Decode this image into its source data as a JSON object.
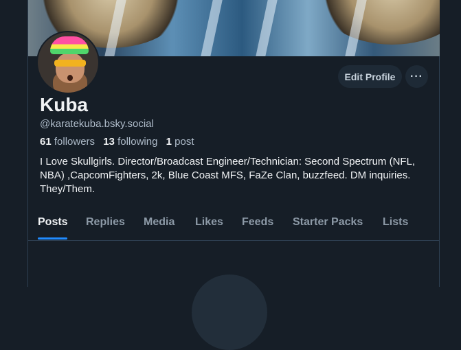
{
  "profile": {
    "display_name": "Kuba",
    "handle": "@karatekuba.bsky.social",
    "followers_count": "61",
    "followers_label": "followers",
    "following_count": "13",
    "following_label": "following",
    "posts_count": "1",
    "posts_label": "post",
    "bio": "I Love Skullgirls. Director/Broadcast Engineer/Technician: Second Spectrum (NFL, NBA) ,CapcomFighters, 2k, Blue Coast MFS, FaZe Clan, buzzfeed. DM inquiries. They/Them."
  },
  "actions": {
    "edit_profile_label": "Edit Profile",
    "more_label": "···"
  },
  "tabs": [
    {
      "label": "Posts",
      "active": true
    },
    {
      "label": "Replies",
      "active": false
    },
    {
      "label": "Media",
      "active": false
    },
    {
      "label": "Likes",
      "active": false
    },
    {
      "label": "Feeds",
      "active": false
    },
    {
      "label": "Starter Packs",
      "active": false
    },
    {
      "label": "Lists",
      "active": false
    }
  ],
  "colors": {
    "background": "#161e27",
    "accent": "#208bfe",
    "button_bg": "#1e2a36",
    "muted_text": "#aebbc9"
  }
}
